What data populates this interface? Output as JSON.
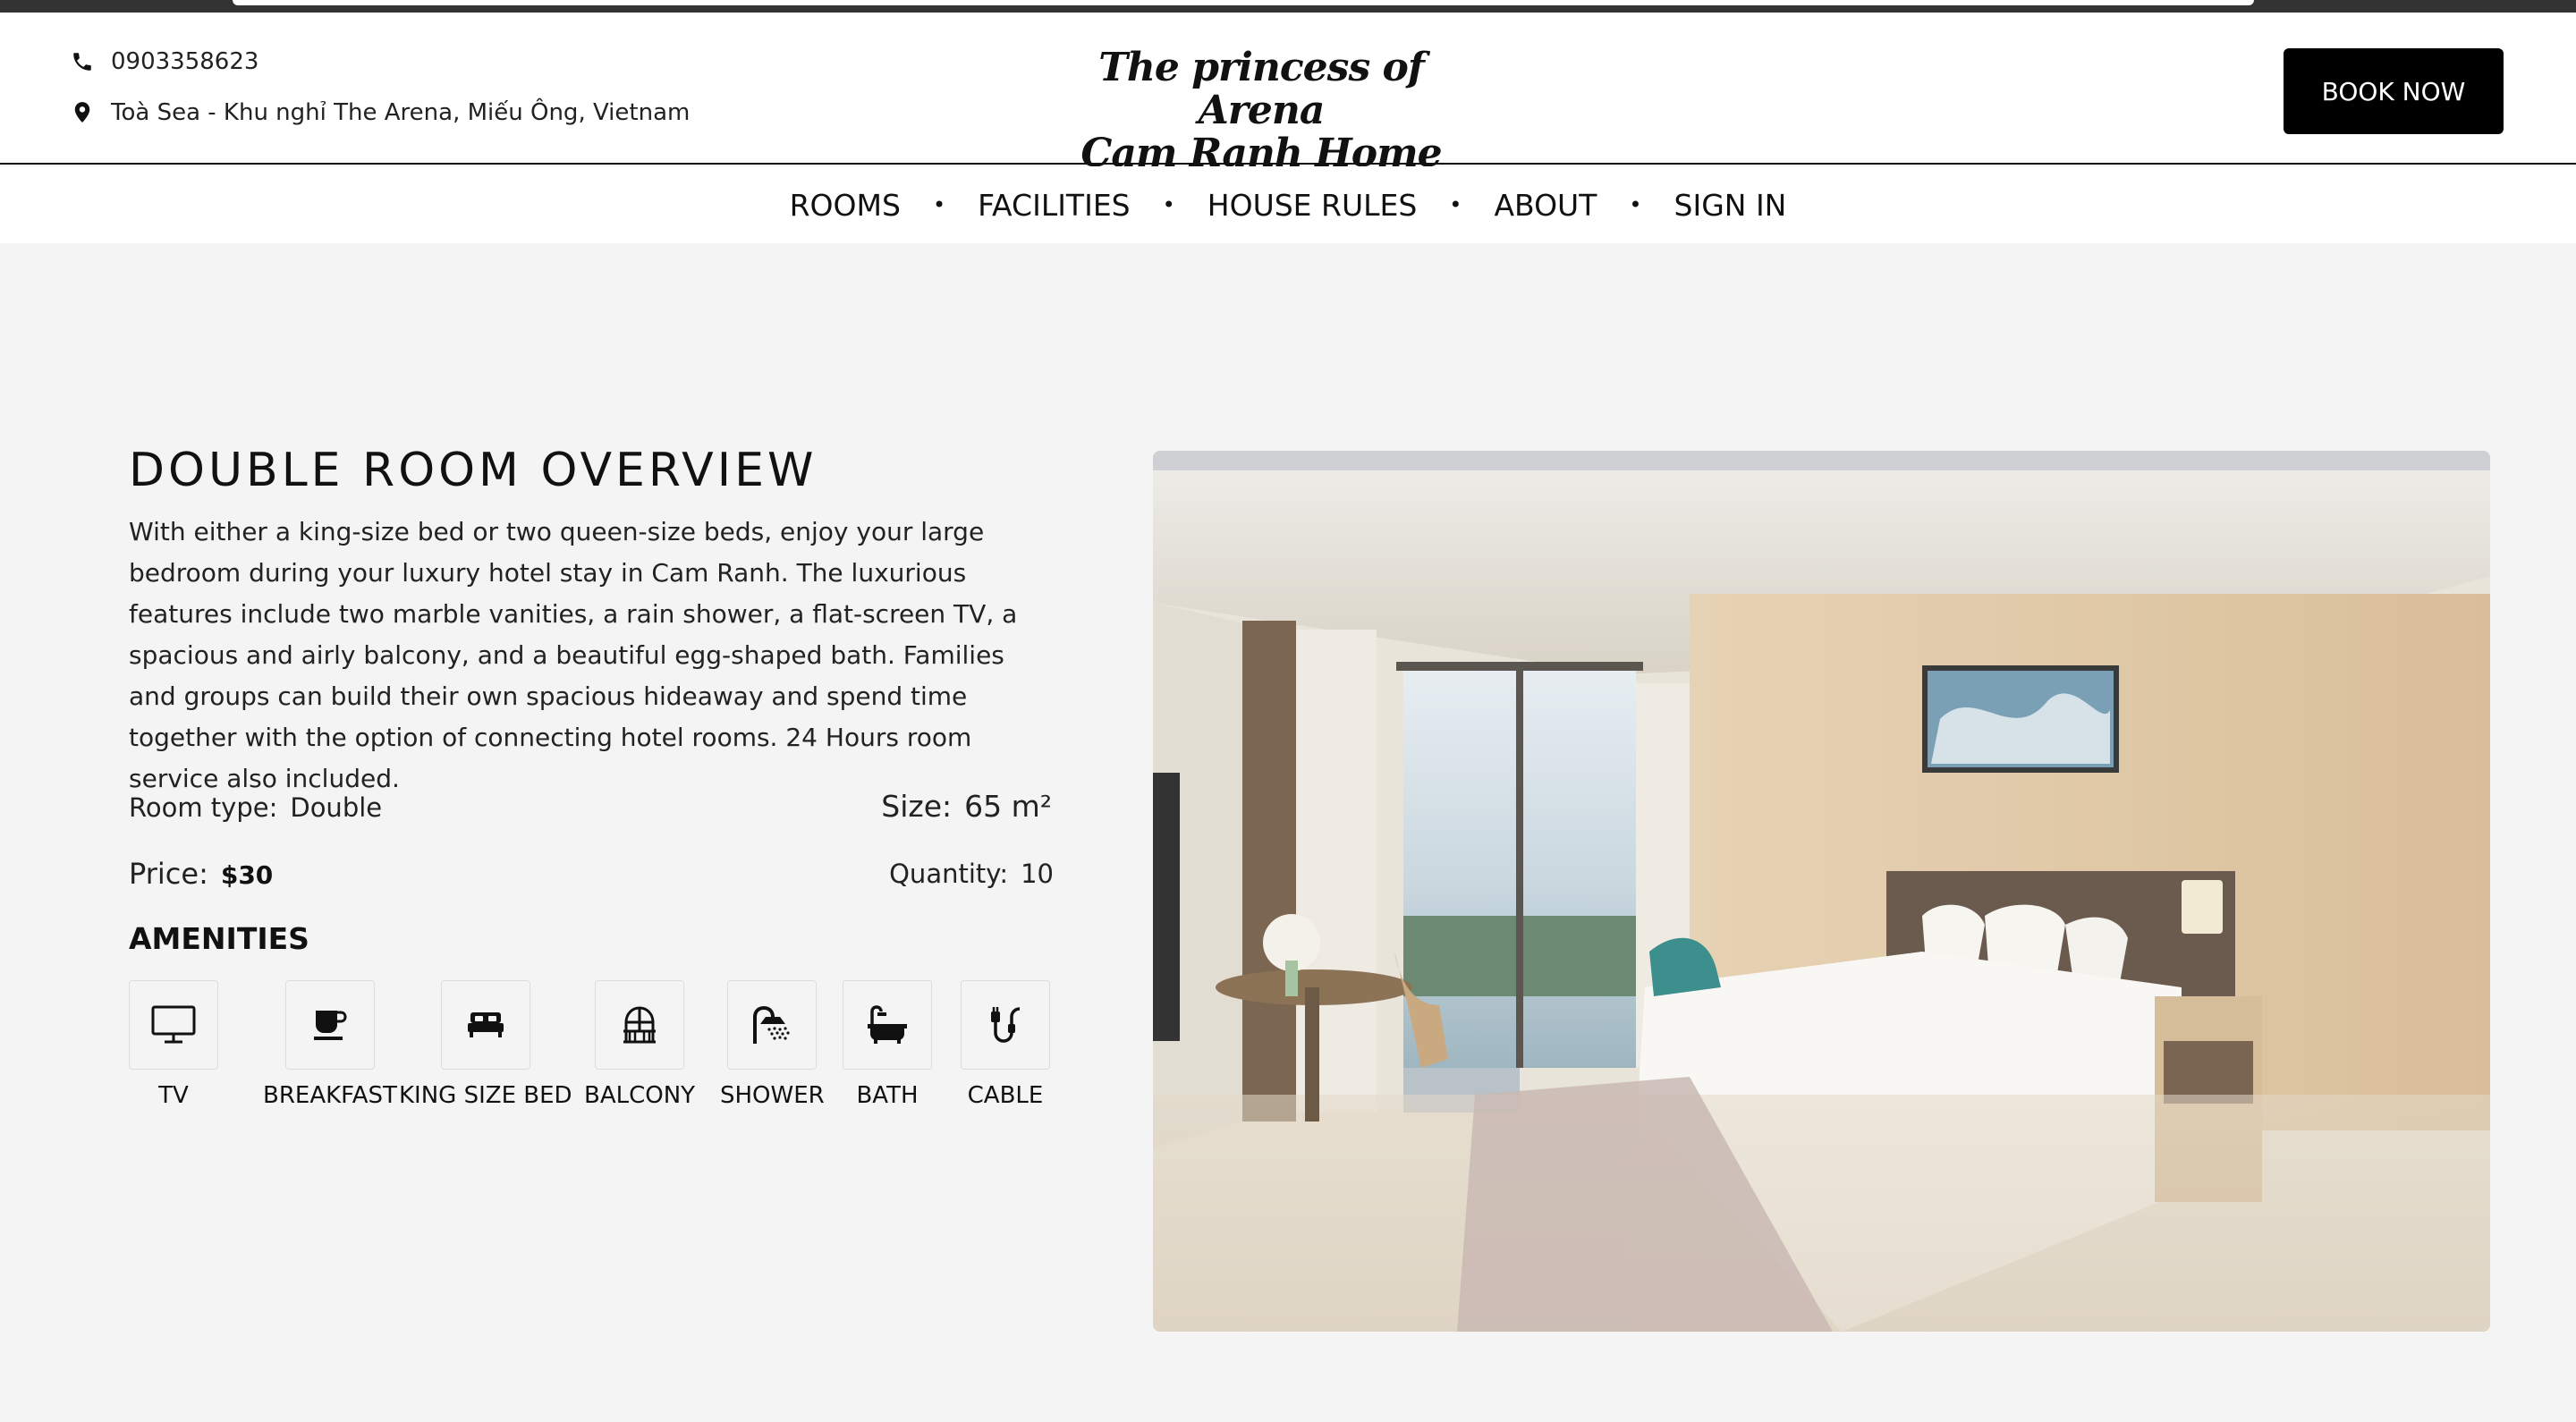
{
  "header": {
    "phone": "0903358623",
    "address": "Toà Sea - Khu nghỉ The Arena, Miếu Ông, Vietnam",
    "logo_line1": "The princess of Arena",
    "logo_line2": "Cam Ranh Home",
    "book_button": "BOOK NOW"
  },
  "nav": {
    "items": [
      "ROOMS",
      "FACILITIES",
      "HOUSE RULES",
      "ABOUT",
      "SIGN IN"
    ]
  },
  "room": {
    "title": "DOUBLE ROOM OVERVIEW",
    "description": "With either a king-size bed or two queen-size beds, enjoy your large bedroom during your luxury hotel stay in Cam Ranh. The luxurious features include two marble vanities, a rain shower, a flat-screen TV, a spacious and airly balcony, and a beautiful egg-shaped bath.  Families and groups can build their own spacious hideaway and spend time together with the option of connecting hotel rooms. 24 Hours room service also included.",
    "room_type_label": "Room type:",
    "room_type_value": "Double",
    "size_label": "Size:",
    "size_value": "65 m²",
    "price_label": "Price:",
    "price_value": "$30",
    "quantity_label": "Quantity:",
    "quantity_value": "10",
    "amenities_title": "AMENITIES",
    "amenities": [
      {
        "label": "TV",
        "icon": "tv-icon"
      },
      {
        "label": "BREAKFAST",
        "icon": "coffee-cup-icon"
      },
      {
        "label": "KING SIZE BED",
        "icon": "bed-icon"
      },
      {
        "label": "BALCONY",
        "icon": "balcony-icon"
      },
      {
        "label": "SHOWER",
        "icon": "shower-icon"
      },
      {
        "label": "BATH",
        "icon": "bathtub-icon"
      },
      {
        "label": "CABLE",
        "icon": "cable-icon"
      }
    ]
  },
  "colors": {
    "page_bg": "#f4f4f4",
    "button_bg": "#000000",
    "text": "#111111"
  }
}
